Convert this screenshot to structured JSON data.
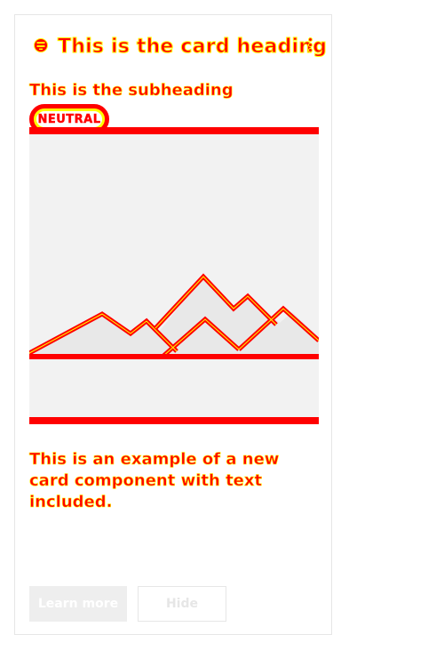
{
  "card": {
    "title": "This is the card heading",
    "subheading": "This is the subheading",
    "status_badge": "NEUTRAL",
    "body_text": "This is an example of a new card component with text included.",
    "icons": {
      "header": "card-icon",
      "menu": "more-vertical-icon",
      "media": "image-placeholder-icon"
    },
    "buttons": {
      "primary": "Learn more",
      "secondary": "Hide"
    }
  },
  "colors": {
    "accent": "#ff0000",
    "highlight": "#ffff00",
    "media_background": "#f2f2f2",
    "card_border": "#e6e6e6"
  }
}
